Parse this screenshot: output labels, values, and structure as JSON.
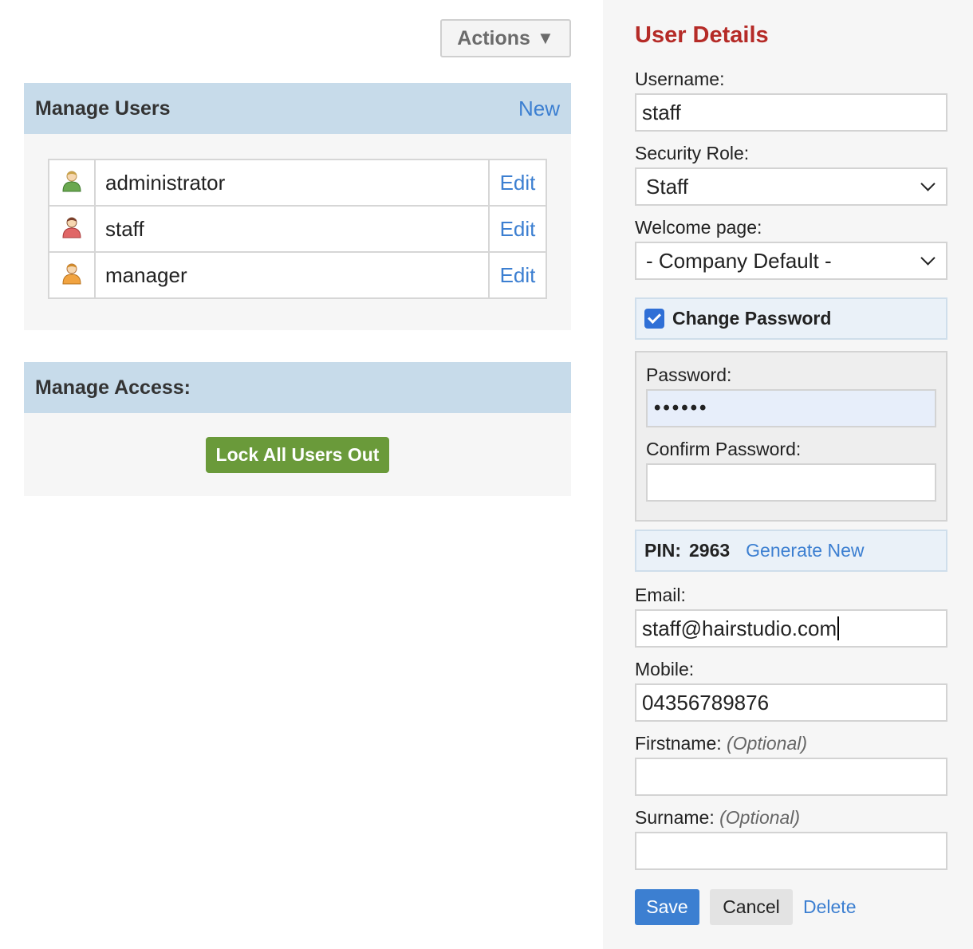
{
  "toolbar": {
    "actions_label": "Actions",
    "actions_icon": "triangle-down-icon"
  },
  "manage_users": {
    "title": "Manage Users",
    "new_label": "New",
    "users": [
      {
        "name": "administrator",
        "icon": "user-icon",
        "icon_color": "#6aa84f",
        "edit_label": "Edit"
      },
      {
        "name": "staff",
        "icon": "user-icon",
        "icon_color": "#e06666",
        "edit_label": "Edit"
      },
      {
        "name": "manager",
        "icon": "user-icon",
        "icon_color": "#f1a340",
        "edit_label": "Edit"
      }
    ]
  },
  "manage_access": {
    "title": "Manage Access:",
    "lock_label": "Lock All Users Out"
  },
  "details": {
    "title": "User Details",
    "username_label": "Username:",
    "username_value": "staff",
    "role_label": "Security Role:",
    "role_value": "Staff",
    "welcome_label": "Welcome page:",
    "welcome_value": "- Company Default -",
    "change_password_label": "Change Password",
    "change_password_checked": true,
    "password_label": "Password:",
    "password_value": "••••••",
    "confirm_password_label": "Confirm Password:",
    "confirm_password_value": "",
    "pin_label": "PIN:",
    "pin_value": "2963",
    "generate_label": "Generate New",
    "email_label": "Email:",
    "email_value": "staff@hairstudio.com",
    "mobile_label": "Mobile:",
    "mobile_value": "04356789876",
    "firstname_label": "Firstname:",
    "surname_label": "Surname:",
    "optional_text": "(Optional)",
    "firstname_value": "",
    "surname_value": "",
    "save_label": "Save",
    "cancel_label": "Cancel",
    "delete_label": "Delete"
  },
  "colors": {
    "accent": "#3c7fd1",
    "title_red": "#b52b27",
    "header_blue": "#c7dbea",
    "lock_green": "#6a9a3a"
  }
}
